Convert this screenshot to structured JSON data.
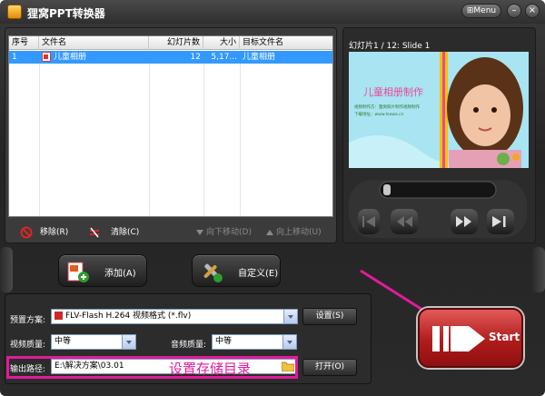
{
  "window": {
    "title": "狸窝PPT转换器",
    "menu_label": "Menu"
  },
  "table": {
    "headers": [
      "序号",
      "文件名",
      "幻灯片数",
      "大小",
      "目标文件名"
    ],
    "rows": [
      {
        "index": "1",
        "filename": "儿童相册",
        "slides": "12",
        "size": "5,17...",
        "target": "儿童相册"
      }
    ]
  },
  "actions": {
    "remove": "移除(R)",
    "clear": "清除(C)",
    "move_down": "向下移动(D)",
    "move_up": "向上移动(U)"
  },
  "buttons": {
    "add": "添加(A)",
    "customize": "自定义(E)",
    "settings": "设置(S)",
    "open": "打开(O)",
    "start": "Start"
  },
  "preview": {
    "label": "幻灯片1 / 12: Slide 1",
    "slide_title": "儿童相册制作",
    "slide_line1": "视频制作方：狸窝照片制作视频制作",
    "slide_line2": "下载地址：www.leawo.cn"
  },
  "settings": {
    "preset_label": "预置方案:",
    "preset_value": "FLV-Flash H.264 视频格式 (*.flv)",
    "video_quality_label": "视频质量:",
    "video_quality_value": "中等",
    "audio_quality_label": "音频质量:",
    "audio_quality_value": "中等",
    "output_label": "输出路径:",
    "output_value": "E:\\解决方案\\03.01"
  },
  "annotation": {
    "text": "设置存储目录"
  },
  "colors": {
    "accent_highlight": "#e21b9b",
    "selection": "#3399ff",
    "start_red": "#c02020"
  }
}
